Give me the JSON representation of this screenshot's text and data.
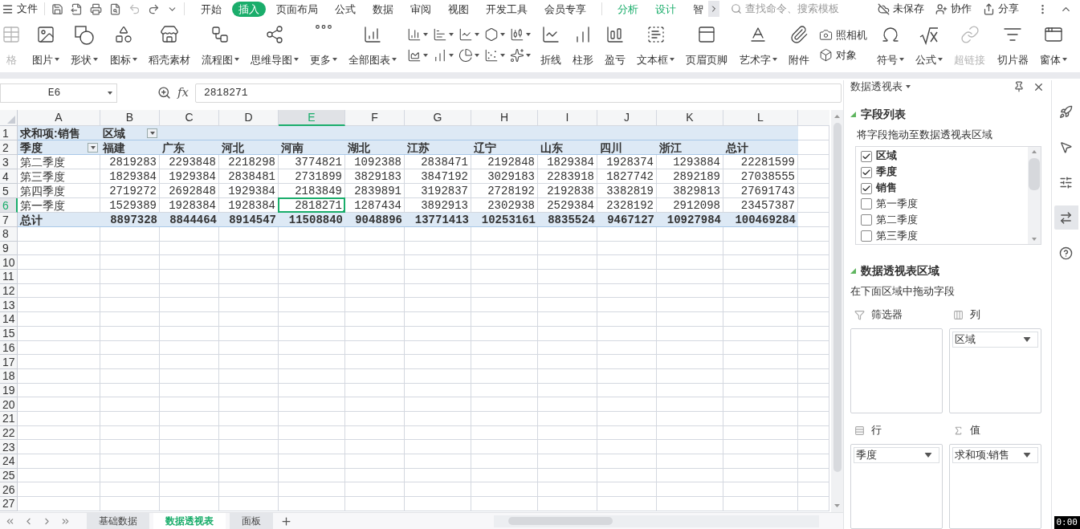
{
  "menu_bar": {
    "file_menu": "文件",
    "tabs": [
      {
        "label": "开始",
        "selected": false,
        "contextual": false
      },
      {
        "label": "插入",
        "selected": true,
        "contextual": false
      },
      {
        "label": "页面布局",
        "selected": false,
        "contextual": false
      },
      {
        "label": "公式",
        "selected": false,
        "contextual": false
      },
      {
        "label": "数据",
        "selected": false,
        "contextual": false
      },
      {
        "label": "审阅",
        "selected": false,
        "contextual": false
      },
      {
        "label": "视图",
        "selected": false,
        "contextual": false
      },
      {
        "label": "开发工具",
        "selected": false,
        "contextual": false
      },
      {
        "label": "会员专享",
        "selected": false,
        "contextual": false
      },
      {
        "label": "分析",
        "selected": false,
        "contextual": true
      },
      {
        "label": "设计",
        "selected": false,
        "contextual": true
      },
      {
        "label": "智",
        "selected": false,
        "contextual": false
      }
    ],
    "search": {
      "placeholder": "查找命令、搜索模板"
    },
    "actions": [
      "未保存",
      "协作",
      "分享"
    ]
  },
  "ribbon": [
    {
      "kind": "large",
      "label": "格",
      "dropdown": false,
      "disabled": true
    },
    {
      "kind": "large",
      "label": "图片",
      "dropdown": true,
      "disabled": false
    },
    {
      "kind": "large",
      "label": "形状",
      "dropdown": true,
      "disabled": false
    },
    {
      "kind": "large",
      "label": "图标",
      "dropdown": true,
      "disabled": false
    },
    {
      "kind": "large",
      "label": "稻壳素材",
      "dropdown": false,
      "disabled": false
    },
    {
      "kind": "large",
      "label": "流程图",
      "dropdown": true,
      "disabled": false
    },
    {
      "kind": "large",
      "label": "思维导图",
      "dropdown": true,
      "disabled": false
    },
    {
      "kind": "large",
      "label": "更多",
      "dropdown": true,
      "disabled": false
    },
    {
      "kind": "large",
      "label": "全部图表",
      "dropdown": true,
      "disabled": false
    },
    {
      "kind": "chart_gallery"
    },
    {
      "kind": "large",
      "label": "折线",
      "dropdown": false,
      "disabled": false
    },
    {
      "kind": "large",
      "label": "柱形",
      "dropdown": false,
      "disabled": false
    },
    {
      "kind": "large",
      "label": "盈亏",
      "dropdown": false,
      "disabled": false
    },
    {
      "kind": "large",
      "label": "文本框",
      "dropdown": true,
      "disabled": false
    },
    {
      "kind": "large",
      "label": "页眉页脚",
      "dropdown": false,
      "disabled": false
    },
    {
      "kind": "large",
      "label": "艺术字",
      "dropdown": true,
      "disabled": false
    },
    {
      "kind": "large",
      "label": "附件",
      "dropdown": false,
      "disabled": false
    },
    {
      "kind": "stack",
      "items": [
        "照相机",
        "对象"
      ]
    },
    {
      "kind": "large",
      "label": "符号",
      "dropdown": true,
      "disabled": false
    },
    {
      "kind": "large",
      "label": "公式",
      "dropdown": true,
      "disabled": false
    },
    {
      "kind": "large",
      "label": "超链接",
      "dropdown": false,
      "disabled": true
    },
    {
      "kind": "large",
      "label": "切片器",
      "dropdown": false,
      "disabled": false
    },
    {
      "kind": "large",
      "label": "窗体",
      "dropdown": true,
      "disabled": false
    }
  ],
  "formula_bar": {
    "name_box": "E6",
    "function_label": "fx",
    "formula": "2818271"
  },
  "sheet": {
    "columns": [
      {
        "label": "A",
        "selected": false
      },
      {
        "label": "B",
        "selected": false
      },
      {
        "label": "C",
        "selected": false
      },
      {
        "label": "D",
        "selected": false
      },
      {
        "label": "E",
        "selected": true
      },
      {
        "label": "F",
        "selected": false
      },
      {
        "label": "G",
        "selected": false
      },
      {
        "label": "H",
        "selected": false
      },
      {
        "label": "I",
        "selected": false
      },
      {
        "label": "J",
        "selected": false
      },
      {
        "label": "K",
        "selected": false
      },
      {
        "label": "L",
        "selected": false
      }
    ],
    "rows": [
      {
        "number": "1",
        "selected": false,
        "kind": "pivot_title",
        "cells": [
          "求和项:销售",
          "区域"
        ]
      },
      {
        "number": "2",
        "selected": false,
        "kind": "pivot_header",
        "cells": [
          "季度",
          "福建",
          "广东",
          "河北",
          "河南",
          "湖北",
          "江苏",
          "辽宁",
          "山东",
          "四川",
          "浙江",
          "总计"
        ]
      },
      {
        "number": "3",
        "selected": false,
        "kind": "data",
        "cells": [
          "第二季度",
          "2819283",
          "2293848",
          "2218298",
          "3774821",
          "1092388",
          "2838471",
          "2192848",
          "1829384",
          "1928374",
          "1293884",
          "22281599"
        ]
      },
      {
        "number": "4",
        "selected": false,
        "kind": "data",
        "cells": [
          "第三季度",
          "1829384",
          "1929384",
          "2838481",
          "2731899",
          "3829183",
          "3847192",
          "3029183",
          "2283918",
          "1827742",
          "2892189",
          "27038555"
        ]
      },
      {
        "number": "5",
        "selected": false,
        "kind": "data",
        "cells": [
          "第四季度",
          "2719272",
          "2692848",
          "1929384",
          "2183849",
          "2839891",
          "3192837",
          "2728192",
          "2192838",
          "3382819",
          "3829813",
          "27691743"
        ]
      },
      {
        "number": "6",
        "selected": true,
        "kind": "data",
        "cells": [
          "第一季度",
          "1529389",
          "1928384",
          "1928384",
          "2818271",
          "1287434",
          "3892913",
          "2302938",
          "2529384",
          "2328192",
          "2912098",
          "23457387"
        ]
      },
      {
        "number": "7",
        "selected": false,
        "kind": "pivot_total",
        "cells": [
          "总计",
          "8897328",
          "8844464",
          "8914547",
          "11508840",
          "9048896",
          "13771413",
          "10253161",
          "8835524",
          "9467127",
          "10927984",
          "100469284"
        ]
      },
      {
        "number": "8",
        "selected": false,
        "kind": "empty"
      },
      {
        "number": "9",
        "selected": false,
        "kind": "empty"
      },
      {
        "number": "10",
        "selected": false,
        "kind": "empty"
      },
      {
        "number": "11",
        "selected": false,
        "kind": "empty"
      },
      {
        "number": "12",
        "selected": false,
        "kind": "empty"
      },
      {
        "number": "13",
        "selected": false,
        "kind": "empty"
      },
      {
        "number": "14",
        "selected": false,
        "kind": "empty"
      },
      {
        "number": "15",
        "selected": false,
        "kind": "empty"
      },
      {
        "number": "16",
        "selected": false,
        "kind": "empty"
      },
      {
        "number": "17",
        "selected": false,
        "kind": "empty"
      },
      {
        "number": "18",
        "selected": false,
        "kind": "empty"
      },
      {
        "number": "19",
        "selected": false,
        "kind": "empty"
      },
      {
        "number": "20",
        "selected": false,
        "kind": "empty"
      },
      {
        "number": "21",
        "selected": false,
        "kind": "empty"
      },
      {
        "number": "22",
        "selected": false,
        "kind": "empty"
      },
      {
        "number": "23",
        "selected": false,
        "kind": "empty"
      },
      {
        "number": "24",
        "selected": false,
        "kind": "empty"
      },
      {
        "number": "25",
        "selected": false,
        "kind": "empty"
      },
      {
        "number": "26",
        "selected": false,
        "kind": "empty"
      },
      {
        "number": "27",
        "selected": false,
        "kind": "empty"
      }
    ]
  },
  "sheet_tabs": [
    {
      "label": "基础数据",
      "selected": false
    },
    {
      "label": "数据透视表",
      "selected": true
    },
    {
      "label": "面板",
      "selected": false
    }
  ],
  "pivot_panel": {
    "title": "数据透视表",
    "field_section": "字段列表",
    "field_hint": "将字段拖动至数据透视表区域",
    "fields": [
      {
        "label": "区域",
        "checked": true
      },
      {
        "label": "季度",
        "checked": true
      },
      {
        "label": "销售",
        "checked": true
      },
      {
        "label": "第一季度",
        "checked": false
      },
      {
        "label": "第二季度",
        "checked": false
      },
      {
        "label": "第三季度",
        "checked": false
      }
    ],
    "area_section": "数据透视表区域",
    "area_hint": "在下面区域中拖动字段",
    "areas": [
      {
        "kind": "filter",
        "label": "筛选器"
      },
      {
        "kind": "columns",
        "label": "列",
        "items": [
          "区域"
        ]
      },
      {
        "kind": "rows",
        "label": "行",
        "items": [
          "季度"
        ]
      },
      {
        "kind": "values",
        "label": "值",
        "items": [
          "求和项:销售"
        ]
      }
    ]
  },
  "side_tools": [
    {
      "selected": false
    },
    {
      "selected": false
    },
    {
      "selected": false
    },
    {
      "selected": true
    },
    {
      "selected": false
    }
  ],
  "timer": "0:00"
}
